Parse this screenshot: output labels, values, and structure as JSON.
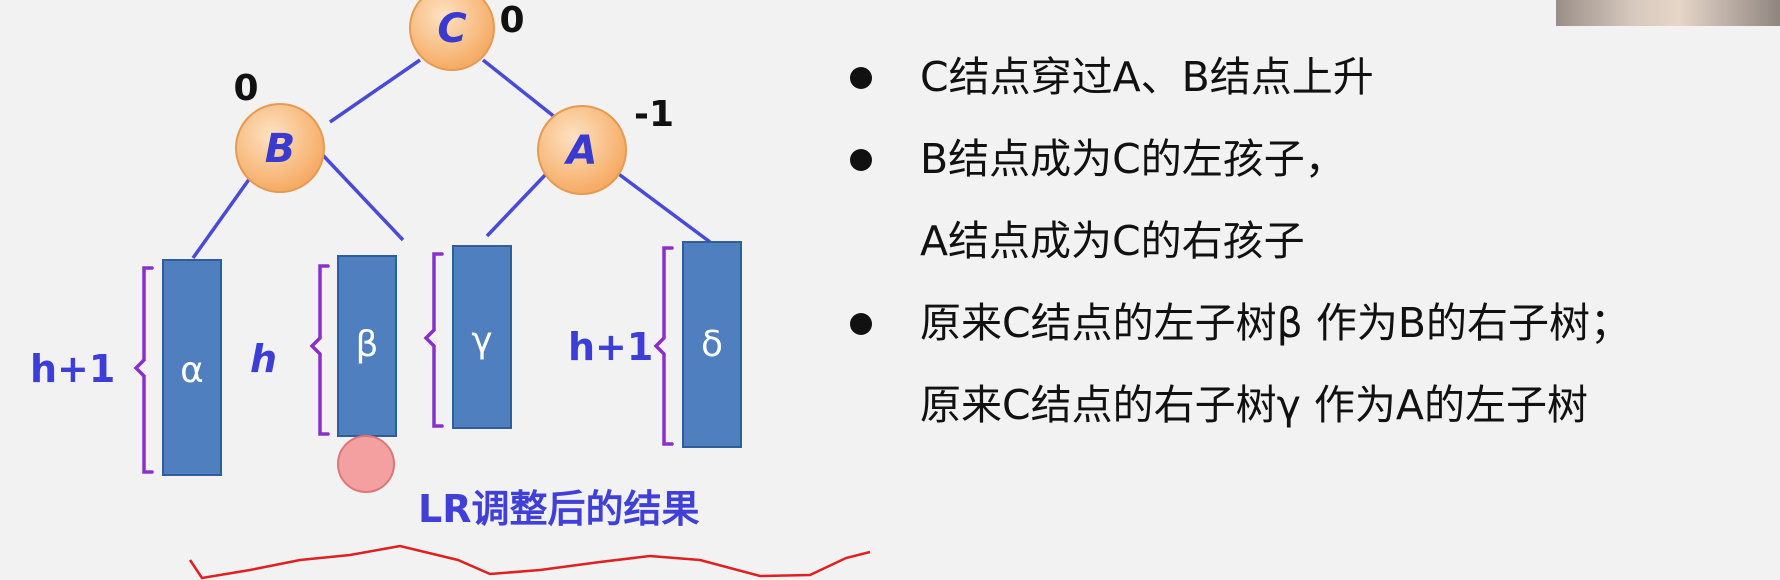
{
  "diagram": {
    "nodes": [
      {
        "id": "C",
        "label": "C",
        "balance": "0"
      },
      {
        "id": "B",
        "label": "B",
        "balance": "0"
      },
      {
        "id": "A",
        "label": "A",
        "balance": "-1"
      }
    ],
    "subtrees": [
      {
        "label": "α",
        "height_label": "h+1"
      },
      {
        "label": "β",
        "height_label": "h"
      },
      {
        "label": "γ",
        "height_label": ""
      },
      {
        "label": "δ",
        "height_label": "h+1"
      }
    ],
    "caption": "LR调整后的结果"
  },
  "bullets": [
    {
      "lines": [
        "C结点穿过A、B结点上升"
      ]
    },
    {
      "lines": [
        "B结点成为C的左孩子，",
        "A结点成为C的右孩子"
      ]
    },
    {
      "lines": [
        "原来C结点的左子树β 作为B的右子树；",
        "原来C结点的右子树γ 作为A的左子树"
      ]
    }
  ],
  "colors": {
    "node_fill": "#f7b777",
    "node_stroke": "#e79a50",
    "node_text": "#3a3ad0",
    "edge": "#4a4ad8",
    "subtree_fill": "#4f7fbf",
    "subtree_stroke": "#2f5f9a",
    "brace": "#8a2fc9",
    "height_text": "#3d3dd8",
    "annotation_line": "#e02020",
    "inserted_node": "#f4a0a0"
  }
}
